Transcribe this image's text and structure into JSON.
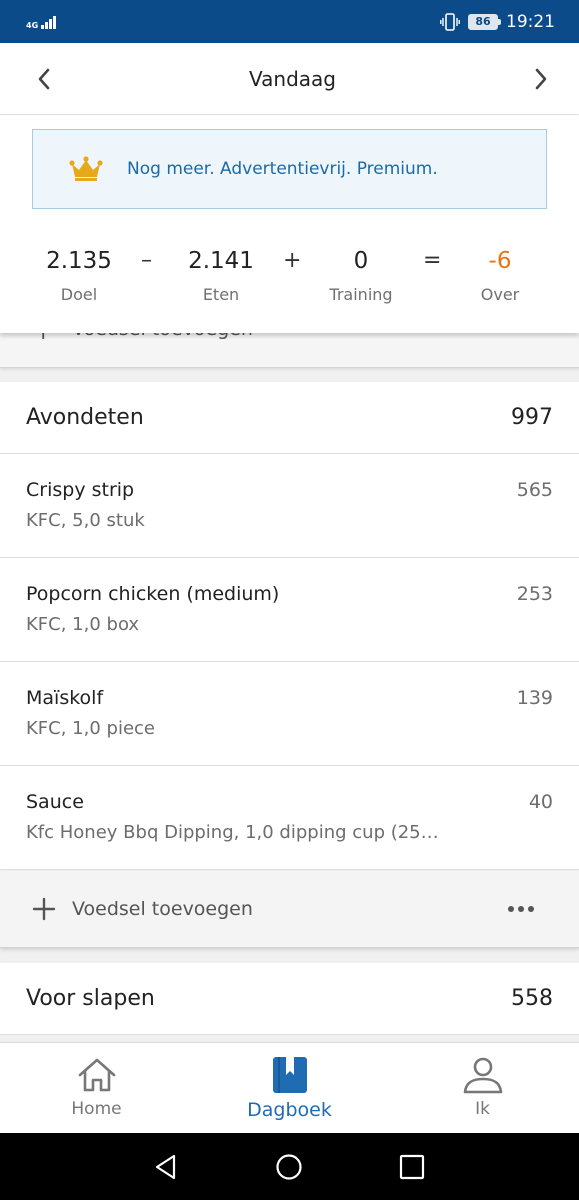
{
  "status_bar": {
    "network": "4G",
    "battery": "86",
    "time": "19:21"
  },
  "header": {
    "title": "Vandaag"
  },
  "premium_banner": {
    "text": "Nog meer. Advertentievrij. Premium."
  },
  "summary": {
    "goal_value": "2.135",
    "goal_label": "Doel",
    "minus": "–",
    "food_value": "2.141",
    "food_label": "Eten",
    "plus": "+",
    "exercise_value": "0",
    "exercise_label": "Training",
    "equals": "=",
    "remaining_value": "-6",
    "remaining_label": "Over"
  },
  "partial_add": {
    "label": "Voedsel toevoegen"
  },
  "dinner": {
    "title": "Avondeten",
    "calories": "997",
    "items": [
      {
        "name": "Crispy strip",
        "detail": "KFC, 5,0 stuk",
        "calories": "565"
      },
      {
        "name": "Popcorn chicken (medium)",
        "detail": "KFC, 1,0 box",
        "calories": "253"
      },
      {
        "name": "Maïskolf",
        "detail": "KFC, 1,0 piece",
        "calories": "139"
      },
      {
        "name": "Sauce",
        "detail": "Kfc Honey Bbq Dipping, 1,0 dipping cup (25…",
        "calories": "40"
      }
    ],
    "add_label": "Voedsel toevoegen"
  },
  "snacks": {
    "title": "Voor slapen",
    "calories": "558"
  },
  "bottom_nav": {
    "items": [
      {
        "label": "Home",
        "icon": "home-icon"
      },
      {
        "label": "Dagboek",
        "icon": "diary-icon"
      },
      {
        "label": "Ik",
        "icon": "profile-icon"
      }
    ],
    "active": "Dagboek"
  },
  "colors": {
    "status_bar": "#0b4b8a",
    "accent": "#1f6cb3",
    "remaining": "#e67519",
    "crown": "#e7a91a"
  }
}
